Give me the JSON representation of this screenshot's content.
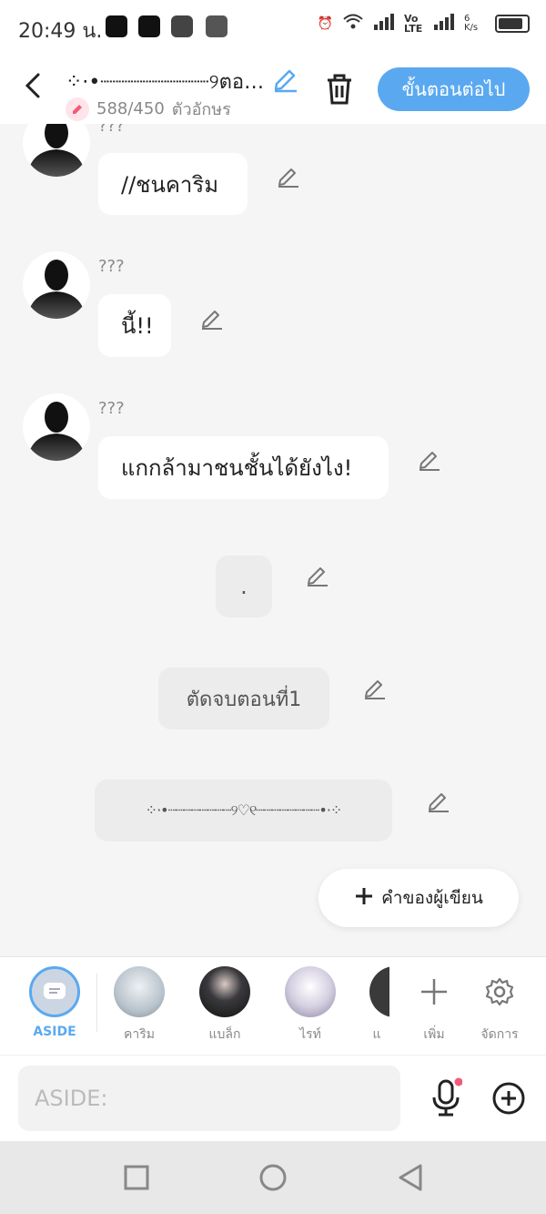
{
  "status": {
    "time": "20:49 น.",
    "lte": "Vo LTE",
    "speed": "6 K/s"
  },
  "header": {
    "title": "⁘⋅•┈┈┈┈┈┈┈┈┈୨ตอ…",
    "counter": "588/450",
    "counter_unit": "ตัวอักษร",
    "next_label": "ขั้นตอนต่อไป"
  },
  "chat": {
    "messages": [
      {
        "speaker": "???",
        "text": "//ชนคาริม"
      },
      {
        "speaker": "???",
        "text": "นี้!!"
      },
      {
        "speaker": "???",
        "text": "แกกล้ามาชนชั้นได้ยังไง!"
      }
    ],
    "notes": [
      {
        "text": "."
      },
      {
        "text": "ตัดจบตอนที่1"
      },
      {
        "text": "⁘⋅•┈┈┈┈┈┈┈┈୨♡୧┈┈┈┈┈┈┈┈•⋅⁘"
      }
    ],
    "author_button": "คำของผู้เขียน"
  },
  "characters": {
    "aside": "ASIDE",
    "items": [
      {
        "name": "คาริม",
        "color": "#b9c3cc"
      },
      {
        "name": "แบล็ก",
        "color": "#2a2a2e"
      },
      {
        "name": "ไรท์",
        "color": "#c8c2d6"
      },
      {
        "name": "แ",
        "color": "#3a3a3a"
      }
    ],
    "add_label": "เพิ่ม",
    "manage_label": "จัดการ"
  },
  "input": {
    "placeholder": "ASIDE:"
  },
  "colors": {
    "accent": "#5aa9f0",
    "pink": "#f25a7a"
  }
}
